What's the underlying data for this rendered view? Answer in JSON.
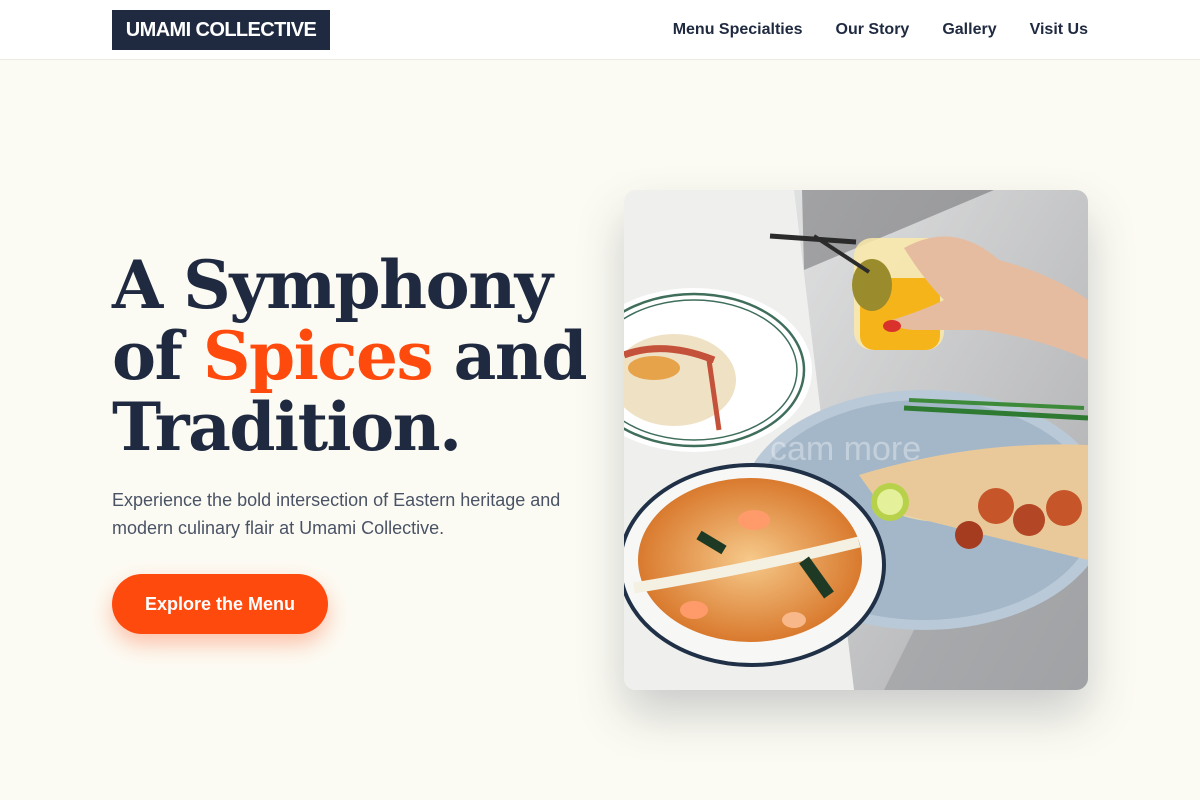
{
  "header": {
    "logo": "UMAMI COLLECTIVE",
    "nav": [
      "Menu Specialties",
      "Our Story",
      "Gallery",
      "Visit Us"
    ]
  },
  "hero": {
    "title_line1": "A Symphony",
    "title_of": "of ",
    "title_accent": "Spices",
    "title_and": " and",
    "title_line3": "Tradition.",
    "description": "Experience the bold intersection of Eastern heritage and modern culinary flair at Umami Collective.",
    "cta_label": "Explore the Menu",
    "image_watermark": "cam more"
  },
  "colors": {
    "brand_navy": "#1f2a40",
    "accent_orange": "#ff4a0e",
    "background_cream": "#fcfbf3"
  }
}
